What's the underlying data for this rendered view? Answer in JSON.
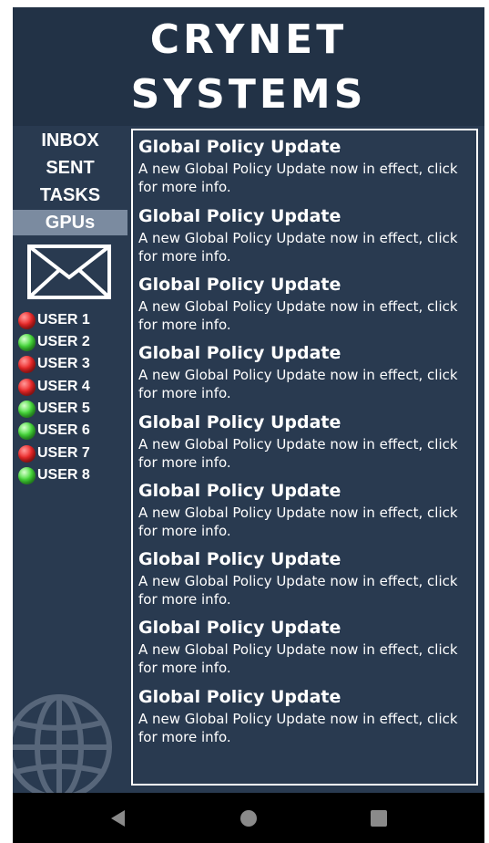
{
  "brand": {
    "line1": "CRYNET",
    "line2": "SYSTEMS"
  },
  "nav": [
    {
      "label": "INBOX"
    },
    {
      "label": "SENT"
    },
    {
      "label": "TASKS"
    },
    {
      "label": "GPUs",
      "active": true
    }
  ],
  "mail_icon": "envelope-icon",
  "users": [
    {
      "label": "USER 1",
      "status": "red"
    },
    {
      "label": "USER 2",
      "status": "green"
    },
    {
      "label": "USER 3",
      "status": "red"
    },
    {
      "label": "USER 4",
      "status": "red"
    },
    {
      "label": "USER 5",
      "status": "green"
    },
    {
      "label": "USER 6",
      "status": "green"
    },
    {
      "label": "USER 7",
      "status": "red"
    },
    {
      "label": "USER 8",
      "status": "green"
    }
  ],
  "messages": [
    {
      "title": "Global Policy Update",
      "body": "A new Global Policy Update now in effect, click for more info."
    },
    {
      "title": "Global Policy Update",
      "body": "A new Global Policy Update now in effect, click for more info."
    },
    {
      "title": "Global Policy Update",
      "body": "A new Global Policy Update now in effect, click for more info."
    },
    {
      "title": "Global Policy Update",
      "body": "A new Global Policy Update now in effect, click for more info."
    },
    {
      "title": "Global Policy Update",
      "body": "A new Global Policy Update now in effect, click for more info."
    },
    {
      "title": "Global Policy Update",
      "body": "A new Global Policy Update now in effect, click for more info."
    },
    {
      "title": "Global Policy Update",
      "body": "A new Global Policy Update now in effect, click for more info."
    },
    {
      "title": "Global Policy Update",
      "body": "A new Global Policy Update now in effect, click for more info."
    },
    {
      "title": "Global Policy Update",
      "body": "A new Global Policy Update now in effect, click for more info."
    }
  ],
  "system_nav": {
    "back": "back-triangle-icon",
    "home": "home-circle-icon",
    "recents": "recents-square-icon"
  },
  "colors": {
    "background": "#293a50",
    "header": "#223246",
    "active_nav": "#7b8ba0",
    "status_red": "#ee2a2a",
    "status_green": "#48dc3c"
  }
}
